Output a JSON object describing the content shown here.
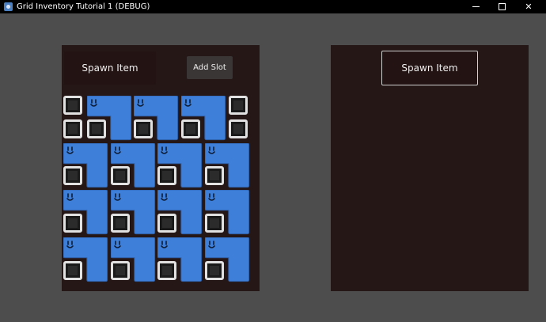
{
  "window": {
    "title": "Grid Inventory Tutorial 1 (DEBUG)"
  },
  "left_panel": {
    "spawn_button": "Spawn Item",
    "add_slot_button": "Add Slot"
  },
  "right_panel": {
    "spawn_button": "Spawn Item"
  },
  "inventory": {
    "columns": 8,
    "rows": 8,
    "item_count": 15,
    "item_color": "#3e7fd9"
  },
  "colors": {
    "background": "#4d4d4d",
    "panel": "#261717",
    "slot_border": "#e1e1e1"
  }
}
